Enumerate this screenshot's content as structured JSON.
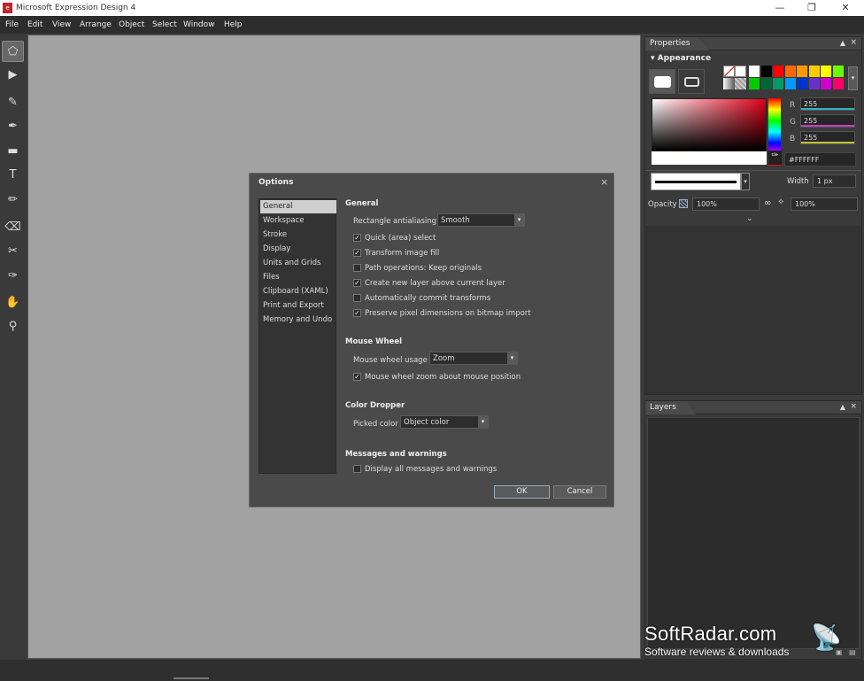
{
  "window": {
    "title": "Microsoft Expression Design 4",
    "icon": "app-icon"
  },
  "menu": [
    "File",
    "Edit",
    "View",
    "Arrange",
    "Object",
    "Select",
    "Window",
    "Help"
  ],
  "tools": [
    "selection-icon",
    "direct-selection-icon",
    "brush-icon",
    "pen-icon",
    "rectangle-icon",
    "text-icon",
    "pencil-icon",
    "eraser-icon",
    "scissors-icon",
    "eyedropper-icon",
    "hand-icon",
    "zoom-icon"
  ],
  "properties": {
    "tab": "Properties",
    "section": "Appearance",
    "r_label": "R",
    "r_value": "255",
    "g_label": "G",
    "g_value": "255",
    "b_label": "B",
    "b_value": "255",
    "hex": "#FFFFFF",
    "width_label": "Width",
    "width_value": "1 px",
    "opacity_label": "Opacity",
    "opacity_value": "100%",
    "opacity2_value": "100%",
    "swatches_row1": [
      "#ffffff",
      "#000000",
      "#ff0000",
      "#ff6600",
      "#ff9900",
      "#ffcc00",
      "#ffff00",
      "#66ff00"
    ],
    "swatches_row2": [
      "#00cc00",
      "#006633",
      "#009966",
      "#0099ff",
      "#0033cc",
      "#6633cc",
      "#cc00cc",
      "#ff0066"
    ]
  },
  "layers": {
    "tab": "Layers"
  },
  "options": {
    "title": "Options",
    "categories": [
      "General",
      "Workspace",
      "Stroke",
      "Display",
      "Units and Grids",
      "Files",
      "Clipboard (XAML)",
      "Print and Export",
      "Memory and Undo"
    ],
    "general": {
      "heading": "General",
      "antialias_label": "Rectangle antialiasing",
      "antialias_value": "Smooth",
      "checks": [
        {
          "label": "Quick (area) select",
          "checked": true
        },
        {
          "label": "Transform image fill",
          "checked": true
        },
        {
          "label": "Path operations: Keep originals",
          "checked": false
        },
        {
          "label": "Create new layer above current layer",
          "checked": true
        },
        {
          "label": "Automatically commit transforms",
          "checked": false
        },
        {
          "label": "Preserve pixel dimensions on bitmap import",
          "checked": true
        }
      ]
    },
    "mouse": {
      "heading": "Mouse Wheel",
      "usage_label": "Mouse wheel usage",
      "usage_value": "Zoom",
      "check_label": "Mouse wheel zoom about mouse position",
      "check_checked": true
    },
    "dropper": {
      "heading": "Color Dropper",
      "picked_label": "Picked color",
      "picked_value": "Object color"
    },
    "messages": {
      "heading": "Messages and warnings",
      "check_label": "Display all messages and warnings",
      "check_checked": false
    },
    "ok": "OK",
    "cancel": "Cancel"
  },
  "watermark": {
    "line1": "SoftRadar.com",
    "line2": "Software reviews & downloads"
  }
}
